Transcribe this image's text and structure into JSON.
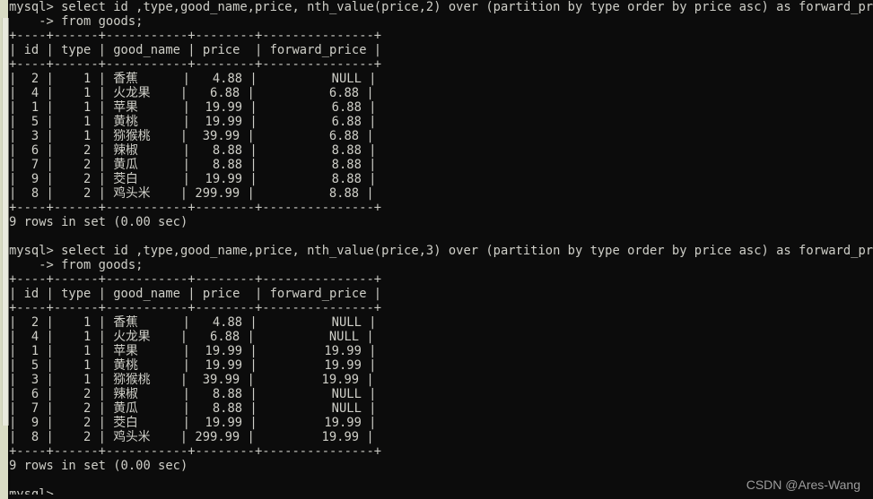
{
  "terminal": {
    "background_color": "#0c0c0c",
    "text_color": "#cfcfc8",
    "prompt": "mysql>",
    "continuation_prompt": "    ->"
  },
  "scrollbar": {
    "track_color": "#d9dcc4",
    "thumb_color": "#e9eade"
  },
  "watermark": {
    "text": "CSDN @Ares-Wang",
    "color": "#9c9c9c"
  },
  "blocks": [
    {
      "id": "query-1",
      "command_line_1": "mysql> select id ,type,good_name,price, nth_value(price,2) over (partition by type order by price asc) as forward_price",
      "command_line_2": "    -> from goods;",
      "table": {
        "top_rule": "+----+------+-----------+--------+---------------+",
        "header_row": "| id | type | good_name | price  | forward_price |",
        "header_rule": "+----+------+-----------+--------+---------------+",
        "rows": [
          "|  2 |    1 | 香蕉      |   4.88 |          NULL |",
          "|  4 |    1 | 火龙果    |   6.88 |          6.88 |",
          "|  1 |    1 | 苹果      |  19.99 |          6.88 |",
          "|  5 |    1 | 黄桃      |  19.99 |          6.88 |",
          "|  3 |    1 | 猕猴桃    |  39.99 |          6.88 |",
          "|  6 |    2 | 辣椒      |   8.88 |          8.88 |",
          "|  7 |    2 | 黄瓜      |   8.88 |          8.88 |",
          "|  9 |    2 | 茭白      |  19.99 |          8.88 |",
          "|  8 |    2 | 鸡头米    | 299.99 |          8.88 |"
        ],
        "bottom_rule": "+----+------+-----------+--------+---------------+"
      },
      "status": "9 rows in set (0.00 sec)"
    },
    {
      "id": "query-2",
      "command_line_1": "mysql> select id ,type,good_name,price, nth_value(price,3) over (partition by type order by price asc) as forward_price",
      "command_line_2": "    -> from goods;",
      "table": {
        "top_rule": "+----+------+-----------+--------+---------------+",
        "header_row": "| id | type | good_name | price  | forward_price |",
        "header_rule": "+----+------+-----------+--------+---------------+",
        "rows": [
          "|  2 |    1 | 香蕉      |   4.88 |          NULL |",
          "|  4 |    1 | 火龙果    |   6.88 |          NULL |",
          "|  1 |    1 | 苹果      |  19.99 |         19.99 |",
          "|  5 |    1 | 黄桃      |  19.99 |         19.99 |",
          "|  3 |    1 | 猕猴桃    |  39.99 |         19.99 |",
          "|  6 |    2 | 辣椒      |   8.88 |          NULL |",
          "|  7 |    2 | 黄瓜      |   8.88 |          NULL |",
          "|  9 |    2 | 茭白      |  19.99 |         19.99 |",
          "|  8 |    2 | 鸡头米    | 299.99 |         19.99 |"
        ],
        "bottom_rule": "+----+------+-----------+--------+---------------+"
      },
      "status": "9 rows in set (0.00 sec)"
    }
  ],
  "trailing_prompt": "mysql>",
  "table_data": {
    "type": "table",
    "columns": [
      "id",
      "type",
      "good_name",
      "price",
      "forward_price"
    ],
    "query1_sql": "select id ,type,good_name,price, nth_value(price,2) over (partition by type order by price asc) as forward_price from goods;",
    "query1_rows": [
      [
        2,
        1,
        "香蕉",
        "4.88",
        "NULL"
      ],
      [
        4,
        1,
        "火龙果",
        "6.88",
        "6.88"
      ],
      [
        1,
        1,
        "苹果",
        "19.99",
        "6.88"
      ],
      [
        5,
        1,
        "黄桃",
        "19.99",
        "6.88"
      ],
      [
        3,
        1,
        "猕猴桃",
        "39.99",
        "6.88"
      ],
      [
        6,
        2,
        "辣椒",
        "8.88",
        "8.88"
      ],
      [
        7,
        2,
        "黄瓜",
        "8.88",
        "8.88"
      ],
      [
        9,
        2,
        "茭白",
        "19.99",
        "8.88"
      ],
      [
        8,
        2,
        "鸡头米",
        "299.99",
        "8.88"
      ]
    ],
    "query2_sql": "select id ,type,good_name,price, nth_value(price,3) over (partition by type order by price asc) as forward_price from goods;",
    "query2_rows": [
      [
        2,
        1,
        "香蕉",
        "4.88",
        "NULL"
      ],
      [
        4,
        1,
        "火龙果",
        "6.88",
        "NULL"
      ],
      [
        1,
        1,
        "苹果",
        "19.99",
        "19.99"
      ],
      [
        5,
        1,
        "黄桃",
        "19.99",
        "19.99"
      ],
      [
        3,
        1,
        "猕猴桃",
        "39.99",
        "19.99"
      ],
      [
        6,
        2,
        "辣椒",
        "8.88",
        "NULL"
      ],
      [
        7,
        2,
        "黄瓜",
        "8.88",
        "NULL"
      ],
      [
        9,
        2,
        "茭白",
        "19.99",
        "19.99"
      ],
      [
        8,
        2,
        "鸡头米",
        "299.99",
        "19.99"
      ]
    ]
  }
}
